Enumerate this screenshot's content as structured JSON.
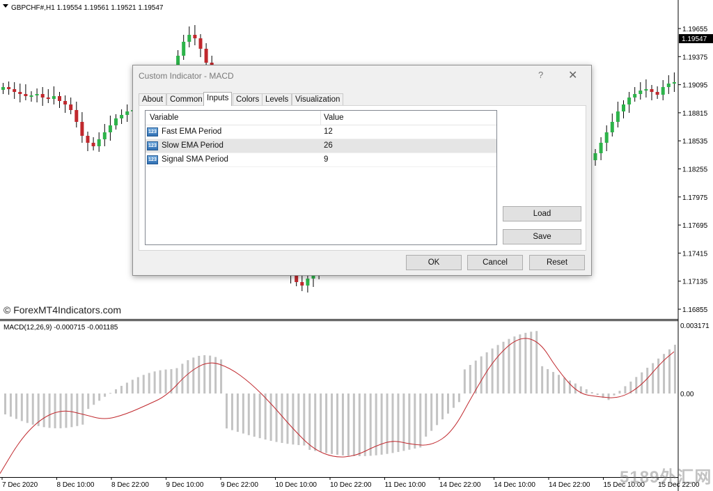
{
  "header": {
    "symbol_info": "GBPCHF#,H1  1.19554 1.19561 1.19521 1.19547",
    "sub_info": "MACD(12,26,9) -0.000715 -0.001185",
    "watermark": "© ForexMT4Indicators.com",
    "corner_watermark": "5189外汇网"
  },
  "price_axis": {
    "labels": [
      "1.19655",
      "1.19375",
      "1.19095",
      "1.18815",
      "1.18535",
      "1.18255",
      "1.17975",
      "1.17695",
      "1.17415",
      "1.17135",
      "1.16855"
    ],
    "current_price": "1.19547"
  },
  "macd_axis": {
    "labels": [
      "0.003171",
      "0.00"
    ]
  },
  "time_axis": {
    "labels": [
      "7 Dec 2020",
      "8 Dec 10:00",
      "8 Dec 22:00",
      "9 Dec 10:00",
      "9 Dec 22:00",
      "10 Dec 10:00",
      "10 Dec 22:00",
      "11 Dec 10:00",
      "14 Dec 22:00",
      "14 Dec 10:00",
      "14 Dec 22:00",
      "15 Dec 10:00",
      "15 Dec 22:00"
    ]
  },
  "colors": {
    "bull": "#2db34a",
    "bear": "#c0282d",
    "signal": "#c0282d",
    "histogram": "#c3c3c3"
  },
  "dialog": {
    "title": "Custom Indicator - MACD",
    "help": "?",
    "close": "✕",
    "tabs": [
      {
        "label": "About"
      },
      {
        "label": "Common"
      },
      {
        "label": "Inputs"
      },
      {
        "label": "Colors"
      },
      {
        "label": "Levels"
      },
      {
        "label": "Visualization"
      }
    ],
    "active_tab": "Inputs",
    "grid": {
      "headers": {
        "variable": "Variable",
        "value": "Value"
      },
      "rows": [
        {
          "icon": "123",
          "variable": "Fast EMA Period",
          "value": "12"
        },
        {
          "icon": "123",
          "variable": "Slow EMA Period",
          "value": "26"
        },
        {
          "icon": "123",
          "variable": "Signal SMA Period",
          "value": "9"
        }
      ]
    },
    "buttons": {
      "load": "Load",
      "save": "Save",
      "ok": "OK",
      "cancel": "Cancel",
      "reset": "Reset"
    }
  }
}
